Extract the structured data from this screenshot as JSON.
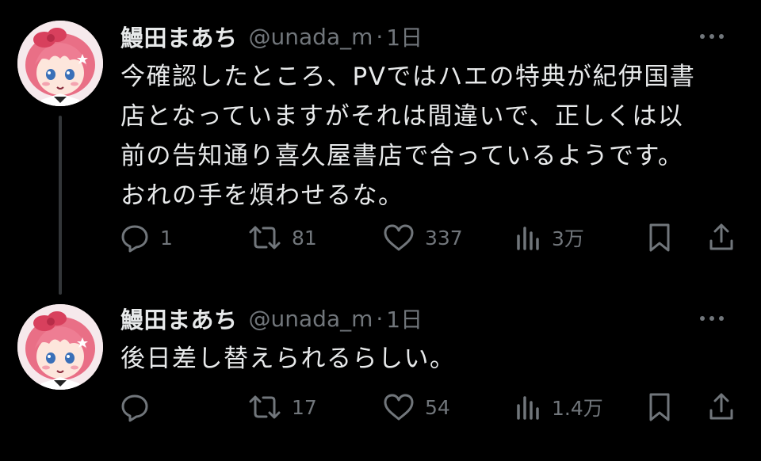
{
  "tweets": [
    {
      "display_name": "鰻田まあち",
      "handle": "@unada_m",
      "separator": "·",
      "time": "1日",
      "text": "今確認したところ、PVではハエの特典が紀伊国書\n店となっていますがそれは間違いで、正しくは以\n前の告知通り喜久屋書店で合っているようです。\nおれの手を煩わせるな。",
      "replies": "1",
      "retweets": "81",
      "likes": "337",
      "views": "3万"
    },
    {
      "display_name": "鰻田まあち",
      "handle": "@unada_m",
      "separator": "·",
      "time": "1日",
      "text": "後日差し替えられるらしい。",
      "replies": "",
      "retweets": "17",
      "likes": "54",
      "views": "1.4万"
    }
  ],
  "icons": {
    "more": "more-horizontal-icon",
    "reply": "reply-bubble-icon",
    "retweet": "retweet-arrows-icon",
    "like": "heart-icon",
    "views": "bar-chart-icon",
    "bookmark": "bookmark-icon",
    "share": "share-upload-icon"
  },
  "colors": {
    "background": "#000000",
    "primary_text": "#e7e9ea",
    "secondary_text": "#71767b",
    "thread_line": "#333639",
    "avatar_hair": "#e96f86"
  }
}
